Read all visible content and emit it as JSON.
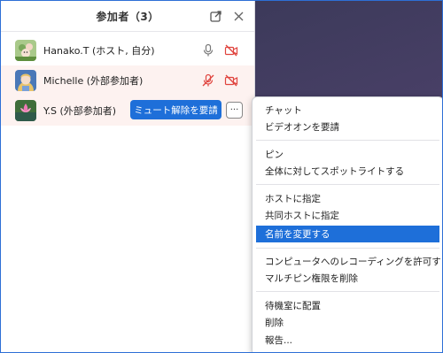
{
  "panel": {
    "title": "参加者（3）"
  },
  "participants": [
    {
      "name": "Hanako.T (ホスト, 自分)"
    },
    {
      "name": "Michelle (外部参加者)"
    },
    {
      "name": "Y.S (外部参加者)",
      "action_label": "ミュート解除を要請",
      "more_label": "···"
    }
  ],
  "menu": {
    "items": [
      "チャット",
      "ビデオオンを要請",
      "ピン",
      "全体に対してスポットライトする",
      "ホストに指定",
      "共同ホストに指定",
      "名前を変更する",
      "コンピュータへのレコーディングを許可する",
      "マルチピン権限を削除",
      "待機室に配置",
      "削除",
      "報告..."
    ],
    "highlighted_item": "名前を変更する"
  },
  "colors": {
    "accent": "#1e6fd9",
    "muted_icon": "#e0443e"
  }
}
